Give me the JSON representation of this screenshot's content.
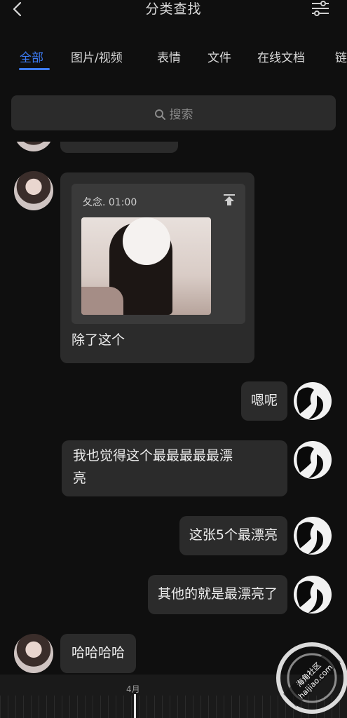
{
  "header": {
    "title": "分类查找"
  },
  "tabs": [
    {
      "label": "全部"
    },
    {
      "label": "图片/视频"
    },
    {
      "label": "表情"
    },
    {
      "label": "文件"
    },
    {
      "label": "在线文档"
    },
    {
      "label": "链"
    }
  ],
  "search": {
    "placeholder": "搜索"
  },
  "messages": {
    "file_card": {
      "meta": "夂念. 01:00",
      "caption": "除了这个"
    },
    "m1": "嗯呢",
    "m2_line1": "我也觉得这个最最最最最漂",
    "m2_line2": "亮",
    "m3": "这张5个最漂亮",
    "m4": "其他的就是最漂亮了",
    "m5": "哈哈哈哈"
  },
  "timeline": {
    "month": "4月"
  },
  "colors": {
    "accent": "#3d7bf3",
    "bubble": "#2b2b2b",
    "background": "#0f0f0f"
  }
}
